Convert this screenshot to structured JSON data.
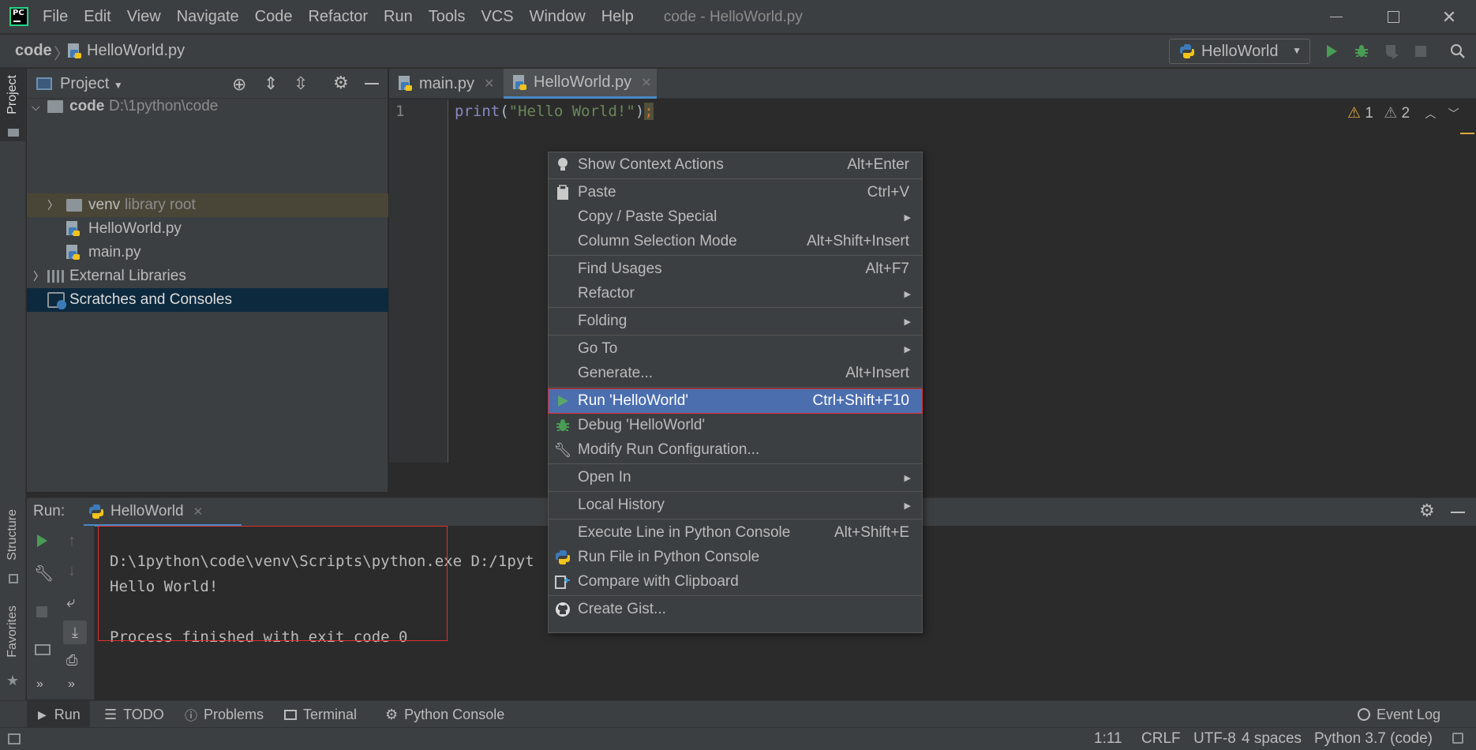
{
  "title": {
    "app_icon": "pycharm-logo",
    "window_title": "code - HelloWorld.py"
  },
  "menus": [
    "File",
    "Edit",
    "View",
    "Navigate",
    "Code",
    "Refactor",
    "Run",
    "Tools",
    "VCS",
    "Window",
    "Help"
  ],
  "breadcrumb": {
    "project": "code",
    "file": "HelloWorld.py"
  },
  "run_config": {
    "label": "HelloWorld"
  },
  "project_panel": {
    "title": "Project",
    "root": {
      "name": "code",
      "path": "D:\\1python\\code"
    },
    "venv": {
      "name": "venv",
      "note": "library root"
    },
    "files": [
      "HelloWorld.py",
      "main.py"
    ],
    "external": "External Libraries",
    "scratches": "Scratches and Consoles"
  },
  "side_strip": {
    "project": "Project",
    "structure": "Structure",
    "favorites": "Favorites"
  },
  "editor": {
    "tabs": [
      {
        "label": "main.py",
        "active": false
      },
      {
        "label": "HelloWorld.py",
        "active": true
      }
    ],
    "line_number": "1",
    "code": {
      "fn": "print",
      "open": "(",
      "str": "\"Hello World!\"",
      "close": ")",
      "semi": ";"
    },
    "warnings": {
      "count_a": "1",
      "count_b": "2"
    }
  },
  "run_panel": {
    "label": "Run:",
    "tab": "HelloWorld",
    "console": [
      "D:\\1python\\code\\venv\\Scripts\\python.exe D:/1pyt",
      "Hello World!",
      "",
      "Process finished with exit code 0"
    ]
  },
  "context_menu": {
    "items": [
      {
        "label": "Show Context Actions",
        "shortcut": "Alt+Enter",
        "icon": "bulb-icon"
      },
      {
        "label": "Paste",
        "shortcut": "Ctrl+V",
        "icon": "clipboard-icon"
      },
      {
        "label": "Copy / Paste Special",
        "submenu": true
      },
      {
        "label": "Column Selection Mode",
        "shortcut": "Alt+Shift+Insert"
      },
      {
        "label": "Find Usages",
        "shortcut": "Alt+F7"
      },
      {
        "label": "Refactor",
        "submenu": true
      },
      {
        "label": "Folding",
        "submenu": true
      },
      {
        "label": "Go To",
        "submenu": true
      },
      {
        "label": "Generate...",
        "shortcut": "Alt+Insert"
      },
      {
        "label": "Run 'HelloWorld'",
        "shortcut": "Ctrl+Shift+F10",
        "icon": "run-icon",
        "highlighted": true
      },
      {
        "label": "Debug 'HelloWorld'",
        "icon": "bug-icon"
      },
      {
        "label": "Modify Run Configuration...",
        "icon": "wrench-icon"
      },
      {
        "label": "Open In",
        "submenu": true
      },
      {
        "label": "Local History",
        "submenu": true
      },
      {
        "label": "Execute Line in Python Console",
        "shortcut": "Alt+Shift+E"
      },
      {
        "label": "Run File in Python Console",
        "icon": "python-icon"
      },
      {
        "label": "Compare with Clipboard",
        "icon": "compare-icon"
      },
      {
        "label": "Create Gist...",
        "icon": "github-icon"
      }
    ]
  },
  "bottom_tabs": [
    "Run",
    "TODO",
    "Problems",
    "Terminal",
    "Python Console"
  ],
  "event_log": "Event Log",
  "status": {
    "position": "1:11",
    "line_sep": "CRLF",
    "encoding": "UTF-8",
    "indent": "4 spaces",
    "interpreter": "Python 3.7 (code)"
  },
  "colors": {
    "accent": "#4b6eaf",
    "run_green": "#499c54",
    "highlight_border": "#e03030"
  }
}
